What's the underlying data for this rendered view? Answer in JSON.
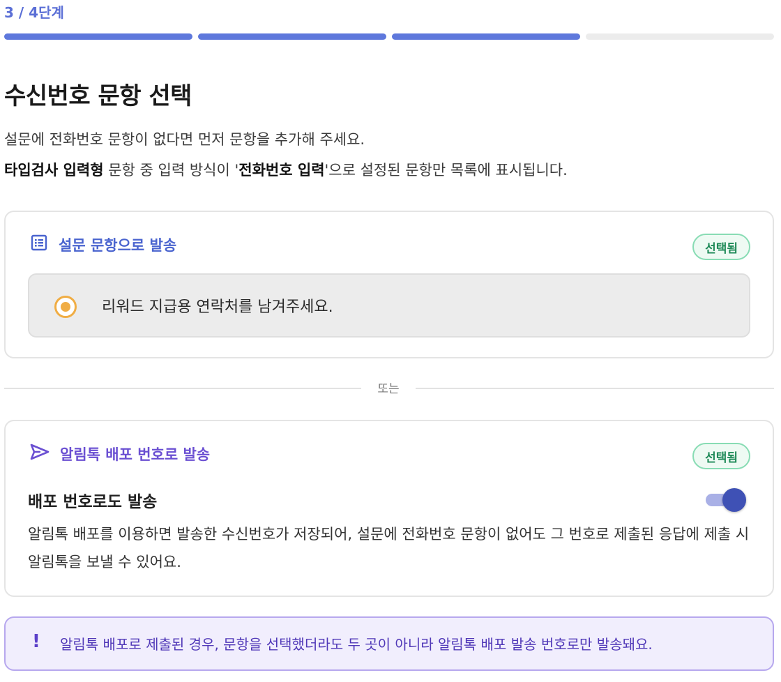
{
  "step": {
    "label": "3 / 4단계",
    "current": 3,
    "total": 4
  },
  "page": {
    "title": "수신번호 문항 선택",
    "desc_line1": "설문에 전화번호 문항이 없다면 먼저 문항을 추가해 주세요.",
    "desc_line2_bold1": "타입검사 입력형",
    "desc_line2_text1": " 문항 중 입력 방식이 '",
    "desc_line2_bold2": "전화번호 입력",
    "desc_line2_text2": "'으로 설정된 문항만 목록에 표시됩니다."
  },
  "survey_card": {
    "icon": "list-icon",
    "title": "설문 문항으로 발송",
    "badge": "선택됨",
    "option_label": "리워드 지급용 연락처를 남겨주세요."
  },
  "divider": {
    "label": "또는"
  },
  "alimtalk_card": {
    "icon": "send-icon",
    "title": "알림톡 배포 번호로 발송",
    "badge": "선택됨",
    "toggle_label": "배포 번호로도 발송",
    "toggle_on": true,
    "description": "알림톡 배포를 이용하면 발송한 수신번호가 저장되어, 설문에 전화번호 문항이 없어도 그 번호로 제출된 응답에 제출 시 알림톡을 보낼 수 있어요."
  },
  "notice": {
    "icon": "!",
    "text": "알림톡 배포로 제출된 경우, 문항을 선택했더라도 두 곳이 아니라 알림톡 배포 발송 번호로만 발송돼요."
  },
  "colors": {
    "progress": "#5e78dc",
    "survey_accent": "#4a64cf",
    "alimtalk_accent": "#6a4fd2",
    "badge": "#1f8a58",
    "radio": "#f0ad44",
    "toggle": "#3f51b5"
  }
}
